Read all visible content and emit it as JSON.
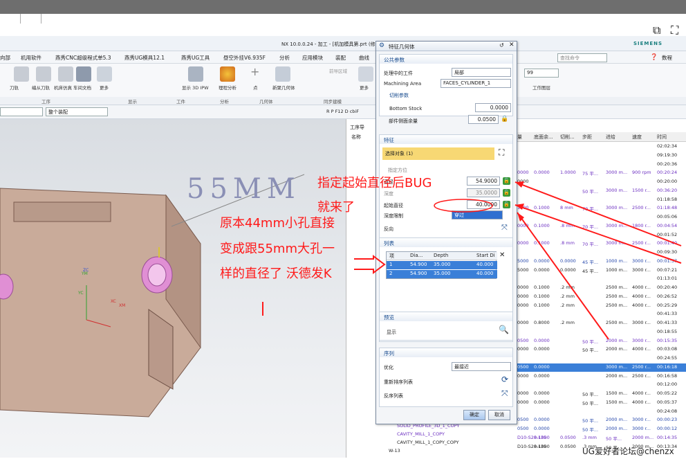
{
  "window": {
    "title": "NX 10.0.0.24 - 加工 - [机加模具第.prt  (修改的)",
    "brand": "SIEMENS"
  },
  "menu": [
    "向部",
    "机用软件",
    "燕秀CNC超级程式单5.3",
    "燕秀UG模具12.1",
    "燕秀UG工具",
    "昼空外挂V6.935F",
    "分析",
    "应用模块",
    "装配",
    "曲线"
  ],
  "ribbon": {
    "buttons": [
      "刀轨",
      "编从刀轨",
      "机床仿真",
      "后处理",
      "车间文档",
      "更多",
      "显示 3D IPW",
      "理程分析",
      "点",
      "新聚几何体",
      "前导区域",
      "更多"
    ],
    "groups": [
      "工序",
      "显示",
      "工件",
      "分析",
      "几何体",
      "同步建模"
    ],
    "right_search": "查找命令",
    "right_label": "工作图层",
    "right_value": "99",
    "data_label": "数程"
  },
  "filterbar": {
    "filter": "",
    "assembly": "整个装配",
    "snap_label": "R P F12 D cbiF"
  },
  "viewport": {
    "dim_text": "55MM",
    "axes": [
      "XC",
      "YC",
      "ZC",
      "XM",
      "YM"
    ]
  },
  "navigator": {
    "title": "工序导",
    "name_col": "名称",
    "columns": [
      "量",
      "底面余...",
      "切削...",
      "步距",
      "进给",
      "速度",
      "时间"
    ],
    "rows": [
      {
        "c": [
          "",
          "",
          "",
          "",
          "",
          "",
          "02:02:34"
        ]
      },
      {
        "c": [
          "",
          "",
          "",
          "",
          "",
          "",
          "09:19:30"
        ]
      },
      {
        "c": [
          "",
          "",
          "",
          "",
          "",
          "",
          "00:20:36"
        ]
      },
      {
        "c": [
          "0000",
          "0.0000",
          "1.0000",
          "75 平...",
          "3000 m...",
          "900 rpm",
          "00:20:24"
        ],
        "cls": "pur"
      },
      {
        "c": [
          "0000",
          "",
          "",
          "",
          "",
          "",
          "00:20:00"
        ]
      },
      {
        "c": [
          "",
          "",
          "",
          "50 平...",
          "3000 m...",
          "1500 r...",
          "00:36:20"
        ],
        "cls": "pur"
      },
      {
        "c": [
          "",
          "",
          "",
          "",
          "",
          "",
          "01:18:58"
        ]
      },
      {
        "c": [
          "1500",
          "0.1000",
          "8 mm",
          "70 平...",
          "3000 m...",
          "2500 r...",
          "01:18:48"
        ],
        "cls": "pur"
      },
      {
        "c": [
          "",
          "",
          "",
          "",
          "",
          "",
          "00:05:06"
        ]
      },
      {
        "c": [
          "0000",
          "0.1000",
          ".8 mm",
          "70 平...",
          "3000 m...",
          "1800 r...",
          "00:04:54"
        ],
        "cls": "pur"
      },
      {
        "c": [
          "",
          "",
          "",
          "",
          "",
          "",
          "00:01:52"
        ]
      },
      {
        "c": [
          "0000",
          "0.1000",
          ".8 mm",
          "70 平...",
          "3000 m...",
          "2500 r...",
          "00:01:40"
        ],
        "cls": "pur"
      },
      {
        "c": [
          "",
          "",
          "",
          "",
          "",
          "",
          "00:09:30"
        ]
      },
      {
        "c": [
          "5000",
          "0.0000",
          "0.0000",
          "45 平...",
          "1000 m...",
          "3000 r...",
          "00:01:57"
        ],
        "cls": "blue"
      },
      {
        "c": [
          "5000",
          "0.0000",
          "0.0000",
          "45 平...",
          "1000 m...",
          "3000 r...",
          "00:07:21"
        ]
      },
      {
        "c": [
          "",
          "",
          "",
          "",
          "",
          "",
          "01:13:01"
        ]
      },
      {
        "c": [
          "0000",
          "0.1000",
          ".2 mm",
          "",
          "2500 m...",
          "4000 r...",
          "00:20:40"
        ]
      },
      {
        "c": [
          "0000",
          "0.1000",
          ".2 mm",
          "",
          "2500 m...",
          "4000 r...",
          "00:26:52"
        ]
      },
      {
        "c": [
          "0000",
          "0.1000",
          ".2 mm",
          "",
          "2500 m...",
          "4000 r...",
          "00:25:29"
        ]
      },
      {
        "c": [
          "",
          "",
          "",
          "",
          "",
          "",
          "00:41:33"
        ]
      },
      {
        "c": [
          "0000",
          "0.8000",
          ".2 mm",
          "",
          "2500 m...",
          "3000 r...",
          "00:41:33"
        ]
      },
      {
        "c": [
          "",
          "",
          "",
          "",
          "",
          "",
          "00:18:55"
        ]
      },
      {
        "c": [
          "0500",
          "0.0000",
          "",
          "50 平...",
          "2000 m...",
          "3000 r...",
          "00:15:35"
        ],
        "cls": "pur"
      },
      {
        "c": [
          "0000",
          "0.0000",
          "",
          "50 平...",
          "2000 m...",
          "4000 r...",
          "00:03:08"
        ]
      },
      {
        "c": [
          "",
          "",
          "",
          "",
          "",
          "",
          "00:24:55"
        ]
      },
      {
        "c": [
          "0500",
          "0.0000",
          "",
          "",
          "3000 m...",
          "2500 r...",
          "00:16:18"
        ],
        "hl": true
      },
      {
        "c": [
          "0000",
          "0.0000",
          "",
          "",
          "2000 m...",
          "2500 r...",
          "00:16:58"
        ]
      },
      {
        "c": [
          "",
          "",
          "",
          "",
          "",
          "",
          "00:12:00"
        ]
      },
      {
        "c": [
          "0000",
          "0.0000",
          "",
          "50 平...",
          "1500 m...",
          "4000 r...",
          "00:05:22"
        ]
      },
      {
        "c": [
          "0000",
          "0.0000",
          "",
          "50 平...",
          "1500 m...",
          "4000 r...",
          "00:05:37"
        ]
      },
      {
        "c": [
          "",
          "",
          "",
          "",
          "",
          "",
          "00:24:08"
        ]
      },
      {
        "c": [
          "0500",
          "0.0000",
          "",
          "50 平...",
          "2000 m...",
          "3000 r...",
          "00:00:23"
        ],
        "cls": "blue"
      },
      {
        "c": [
          "0500",
          "0.0000",
          "",
          "50 平...",
          "2000 m...",
          "3000 r...",
          "00:00:12"
        ],
        "cls": "blue"
      },
      {
        "c": [
          "D10-S28-L35",
          "0.1000",
          "0.0500",
          ".3 mm",
          "50 平...",
          "2000 m...",
          "00:14:35"
        ],
        "cls": "pur"
      },
      {
        "c": [
          "D10-S28-L35",
          "0.1000",
          "0.0500",
          ".3 mm",
          "50 平...",
          "2000 m...",
          "00:13:34"
        ]
      }
    ],
    "ops": [
      "SOLID_PROFILE_3D_1_COPY",
      "CAVITY_MILL_1_COPY",
      "CAVITY_MILL_1_COPY_COPY",
      "W-13"
    ]
  },
  "dialog": {
    "title": "特征几何体",
    "sec_public": "公共参数",
    "workpiece_label": "处理中的工件",
    "workpiece_value": "局部",
    "area_label": "Machining Area",
    "area_value": "FACES_CYLINDER_1",
    "sec_cut": "切削参数",
    "bottom_stock_label": "Bottom Stock",
    "bottom_stock_value": "0.0000",
    "part_stock_label": "部件侧面余量",
    "part_stock_value": "0.0500",
    "sec_feature": "特征",
    "select_obj": "选择对象 (1)",
    "specify_dir": "指定方位",
    "diameter_label": "直径",
    "diameter_value": "54.9000",
    "depth_label": "深度",
    "depth_value": "35.0000",
    "start_dia_label": "起始直径",
    "start_dia_value": "40.0000",
    "depth_limit_label": "深度限制",
    "depth_limit_value": "穿过",
    "reverse_label": "反向",
    "sec_list": "列表",
    "list_cols": [
      "项",
      "Dia...",
      "Depth",
      "Start Di"
    ],
    "list_rows": [
      [
        "1",
        "54.900",
        "35.000",
        "40.000"
      ],
      [
        "2",
        "54.900",
        "35.000",
        "40.000"
      ]
    ],
    "sec_preview": "预览",
    "show_label": "显示",
    "sec_order": "序列",
    "optimize_label": "优化",
    "optimize_value": "最接近",
    "reorder_label": "重新排序列表",
    "reverse_list_label": "反序列表",
    "ok": "确定",
    "cancel": "取消"
  },
  "annotations": {
    "a1": "指定起始直径后BUG",
    "a2": "就来了",
    "a3": "原本44mm小孔直接",
    "a4": "变成跟55mm大孔一",
    "a5": "样的直径了  沃德发K"
  },
  "footer": "UG爱好者论坛@chenzx"
}
